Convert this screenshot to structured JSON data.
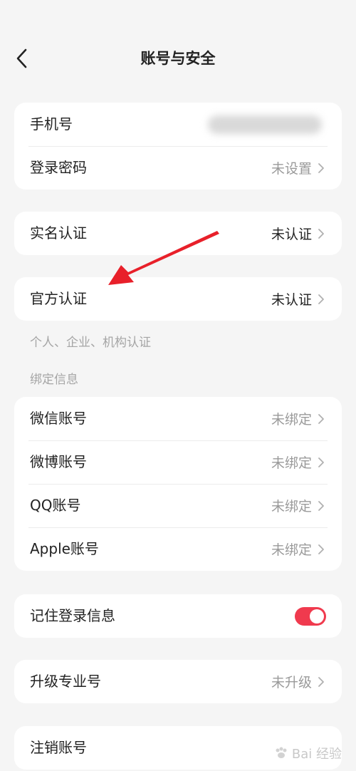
{
  "header": {
    "title": "账号与安全"
  },
  "groups": {
    "account": {
      "phone_label": "手机号",
      "password_label": "登录密码",
      "password_value": "未设置"
    },
    "real_name": {
      "label": "实名认证",
      "value": "未认证"
    },
    "official": {
      "label": "官方认证",
      "value": "未认证",
      "note": "个人、企业、机构认证"
    },
    "binding": {
      "section_title": "绑定信息",
      "items": [
        {
          "label": "微信账号",
          "value": "未绑定"
        },
        {
          "label": "微博账号",
          "value": "未绑定"
        },
        {
          "label": "QQ账号",
          "value": "未绑定"
        },
        {
          "label": "Apple账号",
          "value": "未绑定"
        }
      ]
    },
    "remember": {
      "label": "记住登录信息",
      "enabled": true
    },
    "upgrade": {
      "label": "升级专业号",
      "value": "未升级"
    },
    "cancel": {
      "label": "注销账号"
    }
  },
  "watermark": {
    "text": "Bai 经验"
  },
  "colors": {
    "accent": "#f03a4e",
    "arrow": "#e8202a",
    "muted": "#9a9a9a"
  }
}
